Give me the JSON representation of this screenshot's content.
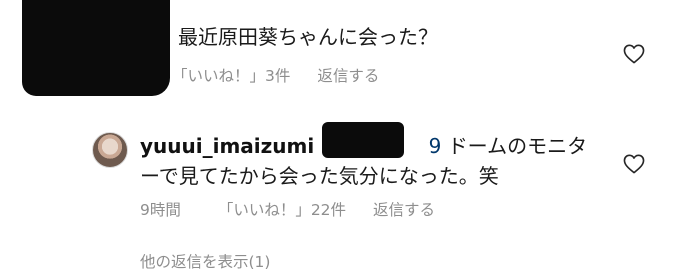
{
  "comments": [
    {
      "text": "最近原田葵ちゃんに会った？",
      "likes": "「いいね！」3件",
      "reply": "返信する"
    },
    {
      "username": "yuuui_imaizumi",
      "mention_prefix": "@",
      "mention_suffix": "9",
      "text_line1": "ドームのモニタ",
      "text_line2": "ーで見てたから会った気分になった。笑",
      "time": "9時間",
      "likes": "「いいね！」22件",
      "reply": "返信する"
    }
  ],
  "view_replies": "他の返信を表示(1)"
}
